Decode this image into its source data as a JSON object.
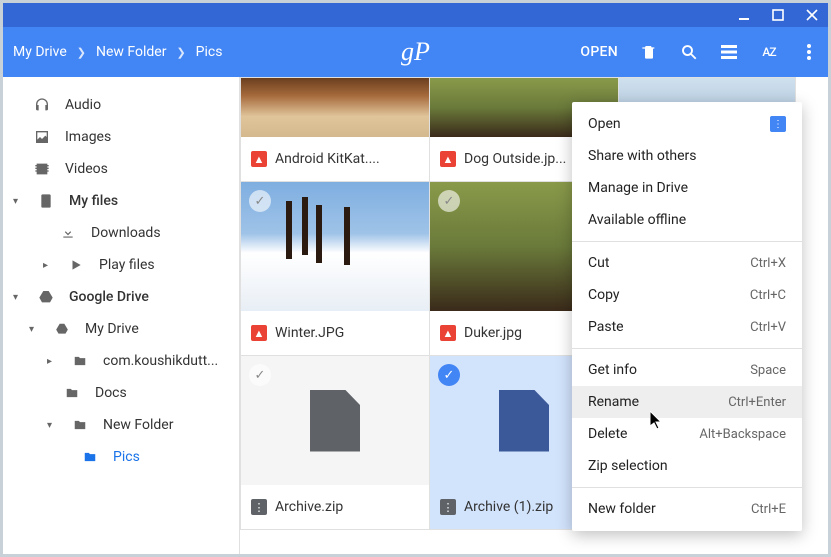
{
  "titlebar": {
    "min": "—",
    "max": "▢",
    "close": "✕"
  },
  "breadcrumb": [
    "My Drive",
    "New Folder",
    "Pics"
  ],
  "logo": "gP",
  "toolbar": {
    "open": "OPEN",
    "sort": "AZ"
  },
  "sidebar": {
    "audio": "Audio",
    "images": "Images",
    "videos": "Videos",
    "myfiles": "My files",
    "downloads": "Downloads",
    "playfiles": "Play files",
    "gdrive": "Google Drive",
    "mydrive": "My Drive",
    "koushik": "com.koushikdutt...",
    "docs": "Docs",
    "newfolder": "New Folder",
    "pics": "Pics"
  },
  "files": [
    {
      "name": "Android KitKat....",
      "type": "img"
    },
    {
      "name": "Dog Outside.jp...",
      "type": "img"
    },
    {
      "name": "Winter.JPG",
      "type": "img"
    },
    {
      "name": "Duker.jpg",
      "type": "img"
    },
    {
      "name": "Archive.zip",
      "type": "zip"
    },
    {
      "name": "Archive (1).zip",
      "type": "zip"
    }
  ],
  "menu": {
    "open": "Open",
    "share": "Share with others",
    "manage": "Manage in Drive",
    "offline": "Available offline",
    "cut": "Cut",
    "cut_s": "Ctrl+X",
    "copy": "Copy",
    "copy_s": "Ctrl+C",
    "paste": "Paste",
    "paste_s": "Ctrl+V",
    "info": "Get info",
    "info_s": "Space",
    "rename": "Rename",
    "rename_s": "Ctrl+Enter",
    "delete": "Delete",
    "delete_s": "Alt+Backspace",
    "zipsel": "Zip selection",
    "newfolder": "New folder",
    "newfolder_s": "Ctrl+E"
  }
}
